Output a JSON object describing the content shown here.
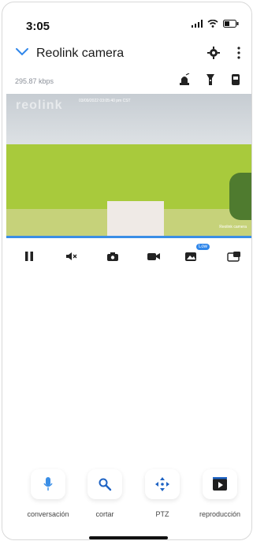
{
  "status_bar": {
    "time": "3:05"
  },
  "header": {
    "title": "Reolink camera"
  },
  "stream": {
    "bitrate": "295.87 kbps",
    "watermark": "reolink",
    "timestamp": "03/09/2022 03:05:40 pm CST",
    "camera_label": "Reolink camera"
  },
  "playback": {
    "progress_percent": 100
  },
  "controls": {
    "quality_badge": "Low"
  },
  "bottom_tabs": [
    {
      "label": "conversación",
      "icon": "microphone-icon"
    },
    {
      "label": "cortar",
      "icon": "search-icon"
    },
    {
      "label": "PTZ",
      "icon": "ptz-icon"
    },
    {
      "label": "reproducción",
      "icon": "playback-icon"
    }
  ],
  "colors": {
    "accent": "#2f86ea",
    "progress": "#3a8ee6"
  }
}
